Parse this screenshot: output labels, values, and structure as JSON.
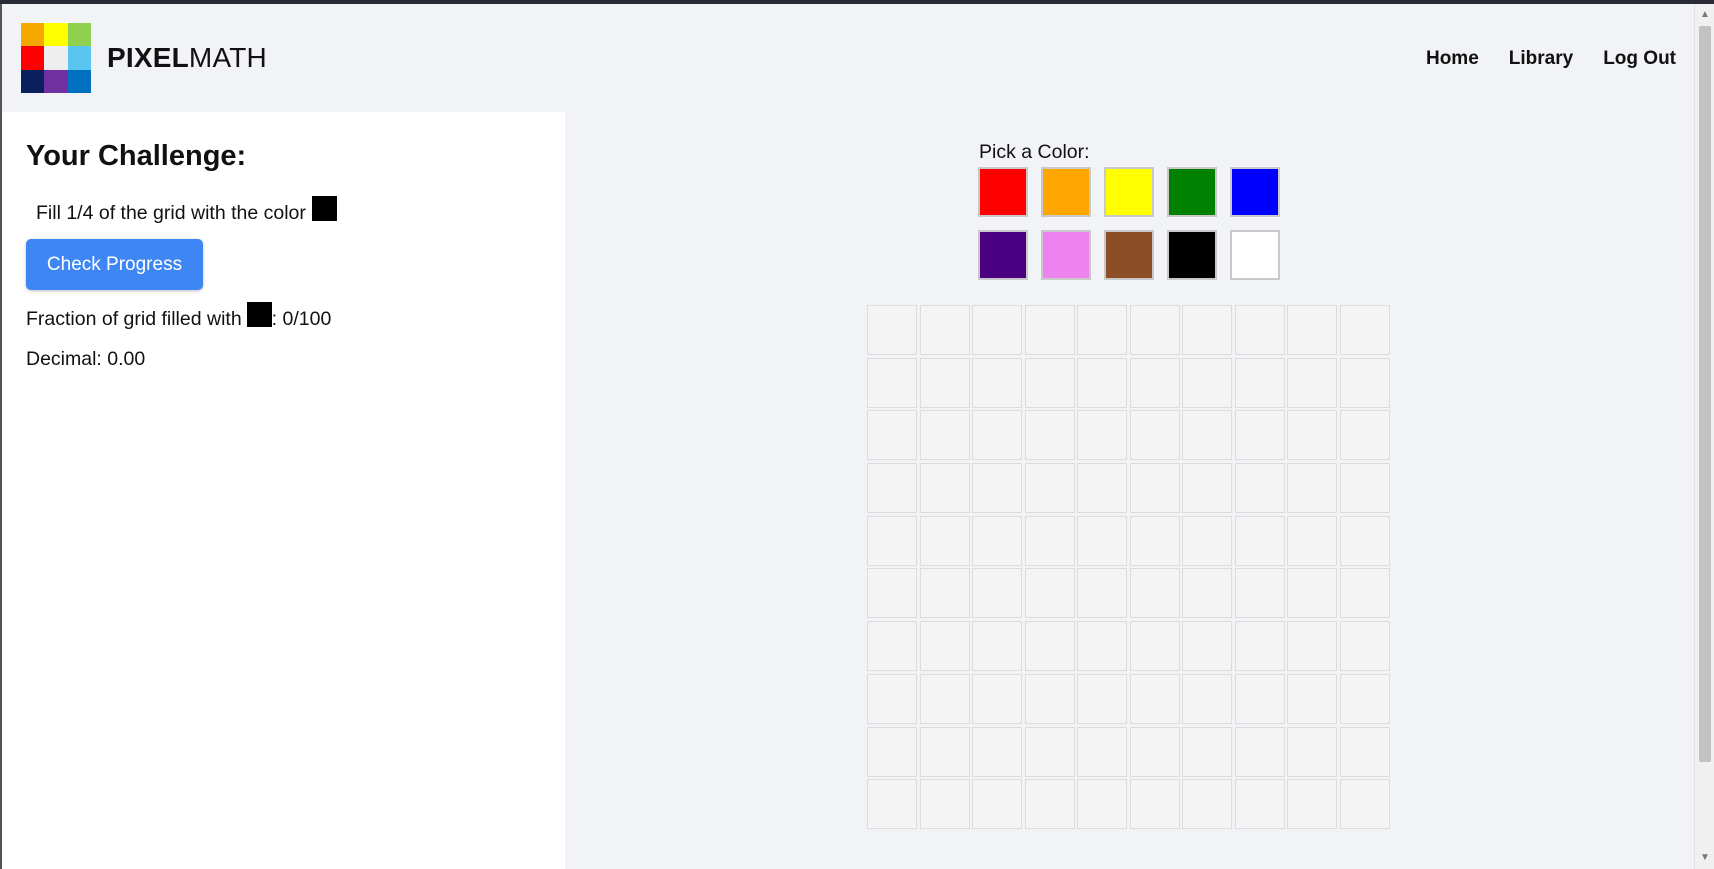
{
  "brand": {
    "bold": "PIXEL",
    "light": "MATH"
  },
  "logo": {
    "colors": [
      "#f5a800",
      "#ffff00",
      "#8fd14f",
      "#ff0000",
      "#eeeeee",
      "#5bc5f2",
      "#0a1f5e",
      "#7030a0",
      "#0070c0"
    ]
  },
  "nav": {
    "home": "Home",
    "library": "Library",
    "logout": "Log Out"
  },
  "challenge": {
    "title": "Your Challenge:",
    "text": "Fill 1/4 of the grid with the color",
    "target_color": "#000000",
    "button": "Check Progress",
    "fraction_label": "Fraction of grid filled with",
    "fraction_value": ": 0/100",
    "decimal": "Decimal: 0.00"
  },
  "picker": {
    "label": "Pick a Color:",
    "colors": [
      {
        "name": "red",
        "hex": "#ff0000"
      },
      {
        "name": "orange",
        "hex": "#ffa500"
      },
      {
        "name": "yellow",
        "hex": "#ffff00"
      },
      {
        "name": "green",
        "hex": "#008000"
      },
      {
        "name": "blue",
        "hex": "#0000ff"
      },
      {
        "name": "indigo",
        "hex": "#4b0082"
      },
      {
        "name": "violet",
        "hex": "#ee82ee"
      },
      {
        "name": "brown",
        "hex": "#8b4e26"
      },
      {
        "name": "black",
        "hex": "#000000"
      },
      {
        "name": "white",
        "hex": "#ffffff"
      }
    ]
  },
  "grid": {
    "rows": 10,
    "cols": 10,
    "filled": 0
  }
}
